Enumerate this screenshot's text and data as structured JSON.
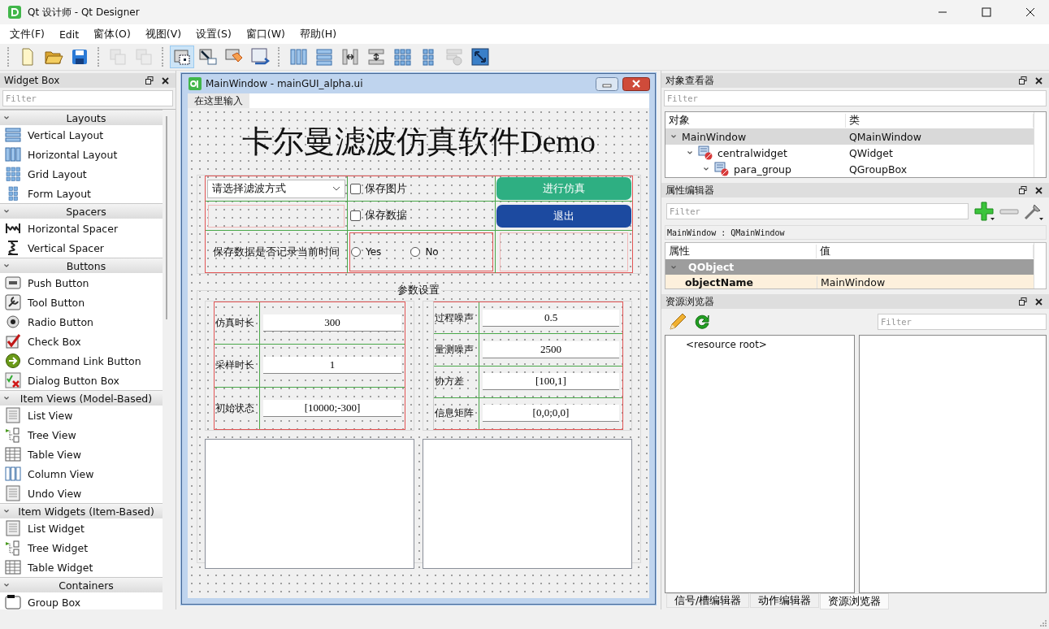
{
  "window": {
    "title": "Qt 设计师 - Qt Designer"
  },
  "menu": [
    "文件(F)",
    "Edit",
    "窗体(O)",
    "视图(V)",
    "设置(S)",
    "窗口(W)",
    "帮助(H)"
  ],
  "toolbar": [
    [
      {
        "kind": "new",
        "selected": false,
        "disabled": false
      },
      {
        "kind": "open",
        "selected": false,
        "disabled": false
      },
      {
        "kind": "save",
        "selected": false,
        "disabled": false
      }
    ],
    [
      {
        "kind": "raise",
        "selected": false,
        "disabled": true
      },
      {
        "kind": "lower",
        "selected": false,
        "disabled": true
      }
    ],
    [
      {
        "kind": "edit-widgets",
        "selected": true,
        "disabled": false
      },
      {
        "kind": "edit-signals",
        "selected": false,
        "disabled": false
      },
      {
        "kind": "edit-buddies",
        "selected": false,
        "disabled": false
      },
      {
        "kind": "edit-tab-order",
        "selected": false,
        "disabled": false
      }
    ],
    [
      {
        "kind": "hlayout",
        "selected": false,
        "disabled": false
      },
      {
        "kind": "vlayout",
        "selected": false,
        "disabled": false
      },
      {
        "kind": "hsplit",
        "selected": false,
        "disabled": false
      },
      {
        "kind": "vsplit",
        "selected": false,
        "disabled": false
      },
      {
        "kind": "grid",
        "selected": false,
        "disabled": false
      },
      {
        "kind": "form",
        "selected": false,
        "disabled": false
      },
      {
        "kind": "break",
        "selected": false,
        "disabled": true
      },
      {
        "kind": "adjust",
        "selected": false,
        "disabled": false
      }
    ]
  ],
  "widget_box": {
    "title": "Widget Box",
    "filter_placeholder": "Filter",
    "categories": [
      {
        "label": "Layouts",
        "expanded": true,
        "items": [
          {
            "label": "Vertical Layout",
            "kind": "vlayout"
          },
          {
            "label": "Horizontal Layout",
            "kind": "hlayout"
          },
          {
            "label": "Grid Layout",
            "kind": "grid"
          },
          {
            "label": "Form Layout",
            "kind": "form"
          }
        ]
      },
      {
        "label": "Spacers",
        "expanded": true,
        "items": [
          {
            "label": "Horizontal Spacer",
            "kind": "hspacer"
          },
          {
            "label": "Vertical Spacer",
            "kind": "vspacer"
          }
        ]
      },
      {
        "label": "Buttons",
        "expanded": true,
        "items": [
          {
            "label": "Push Button",
            "kind": "push"
          },
          {
            "label": "Tool Button",
            "kind": "tool"
          },
          {
            "label": "Radio Button",
            "kind": "radio"
          },
          {
            "label": "Check Box",
            "kind": "check"
          },
          {
            "label": "Command Link Button",
            "kind": "command"
          },
          {
            "label": "Dialog Button Box",
            "kind": "dialog"
          }
        ]
      },
      {
        "label": "Item Views (Model-Based)",
        "expanded": true,
        "items": [
          {
            "label": "List View",
            "kind": "list"
          },
          {
            "label": "Tree View",
            "kind": "tree"
          },
          {
            "label": "Table View",
            "kind": "table"
          },
          {
            "label": "Column View",
            "kind": "column"
          },
          {
            "label": "Undo View",
            "kind": "list"
          }
        ]
      },
      {
        "label": "Item Widgets (Item-Based)",
        "expanded": true,
        "items": [
          {
            "label": "List Widget",
            "kind": "list"
          },
          {
            "label": "Tree Widget",
            "kind": "tree"
          },
          {
            "label": "Table Widget",
            "kind": "table"
          }
        ]
      },
      {
        "label": "Containers",
        "expanded": true,
        "items": [
          {
            "label": "Group Box",
            "kind": "group"
          }
        ]
      }
    ]
  },
  "form_window": {
    "title": "MainWindow - mainGUI_alpha.ui",
    "menu_placeholder": "在这里输入",
    "heading": "卡尔曼滤波仿真软件Demo",
    "combo": {
      "value": "请选择滤波方式"
    },
    "checkboxes": [
      {
        "label": "保存图片",
        "checked": false
      },
      {
        "label": "保存数据",
        "checked": false
      }
    ],
    "buttons": [
      {
        "label": "进行仿真",
        "color": "#2eaf82"
      },
      {
        "label": "退出",
        "color": "#1c4aa0"
      }
    ],
    "radio_question": "保存数据是否记录当前时间",
    "radios": [
      {
        "label": "Yes",
        "selected": false
      },
      {
        "label": "No",
        "selected": false
      }
    ],
    "group": {
      "title": "参数设置",
      "left": [
        {
          "label": "仿真时长",
          "value": "300"
        },
        {
          "label": "采样时长",
          "value": "1"
        },
        {
          "label": "初始状态",
          "value": "[10000;-300]"
        }
      ],
      "right": [
        {
          "label": "过程噪声",
          "value": "0.5"
        },
        {
          "label": "量测噪声",
          "value": "2500"
        },
        {
          "label": "协方差",
          "value": "[100,1]"
        },
        {
          "label": "信息矩阵",
          "value": "[0,0;0,0]"
        }
      ]
    }
  },
  "object_inspector": {
    "title": "对象查看器",
    "filter_placeholder": "Filter",
    "columns": [
      "对象",
      "类"
    ],
    "rows": [
      {
        "name": "MainWindow",
        "class": "QMainWindow",
        "selected": true,
        "expanded": true,
        "children": [
          {
            "name": "centralwidget",
            "class": "QWidget",
            "selected": false,
            "expanded": true,
            "children": [
              {
                "name": "para_group",
                "class": "QGroupBox",
                "selected": false,
                "expanded": true
              }
            ]
          }
        ]
      }
    ]
  },
  "property_editor": {
    "title": "属性编辑器",
    "filter_placeholder": "Filter",
    "object_label": "MainWindow : QMainWindow",
    "columns": [
      "属性",
      "值"
    ],
    "sections": [
      {
        "label": "QObject",
        "expanded": true,
        "properties": [
          {
            "name": "objectName",
            "value": "MainWindow"
          }
        ]
      }
    ]
  },
  "resource_browser": {
    "title": "资源浏览器",
    "filter_placeholder": "Filter",
    "root": "<resource root>"
  },
  "bottom_tabs": [
    {
      "label": "信号/槽编辑器",
      "selected": false
    },
    {
      "label": "动作编辑器",
      "selected": false
    },
    {
      "label": "资源浏览器",
      "selected": true
    }
  ]
}
